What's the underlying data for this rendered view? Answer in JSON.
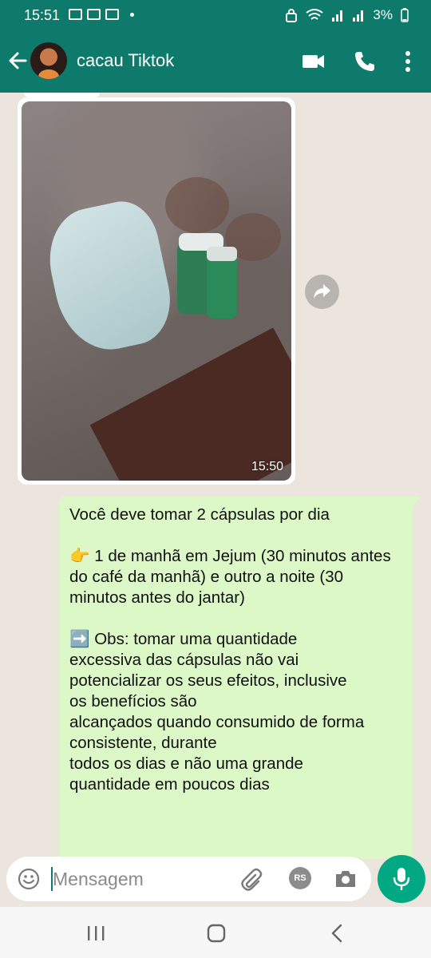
{
  "status_bar": {
    "time": "15:51",
    "battery": "3%"
  },
  "header": {
    "contact_name": "cacau Tiktok"
  },
  "messages": {
    "image_time": "15:50",
    "text": "Você deve tomar 2 cápsulas por dia\n\n👉 1 de manhã em Jejum (30 minutos antes do café da manhã) e outro a noite (30 minutos antes do jantar)\n\n➡️ Obs: tomar uma quantidade\nexcessiva das cápsulas não vai\npotencializar os seus efeitos, inclusive\nos benefícios são\nalcançados quando consumido de forma\nconsistente, durante\ntodos os dias e não uma grande\nquantidade em poucos dias"
  },
  "composer": {
    "placeholder": "Mensagem",
    "badge": "RS"
  },
  "colors": {
    "header": "#0d7a6c",
    "outgoing_bubble": "#dcf8c6",
    "chat_background": "#ece5dd",
    "mic_button": "#00a884"
  }
}
